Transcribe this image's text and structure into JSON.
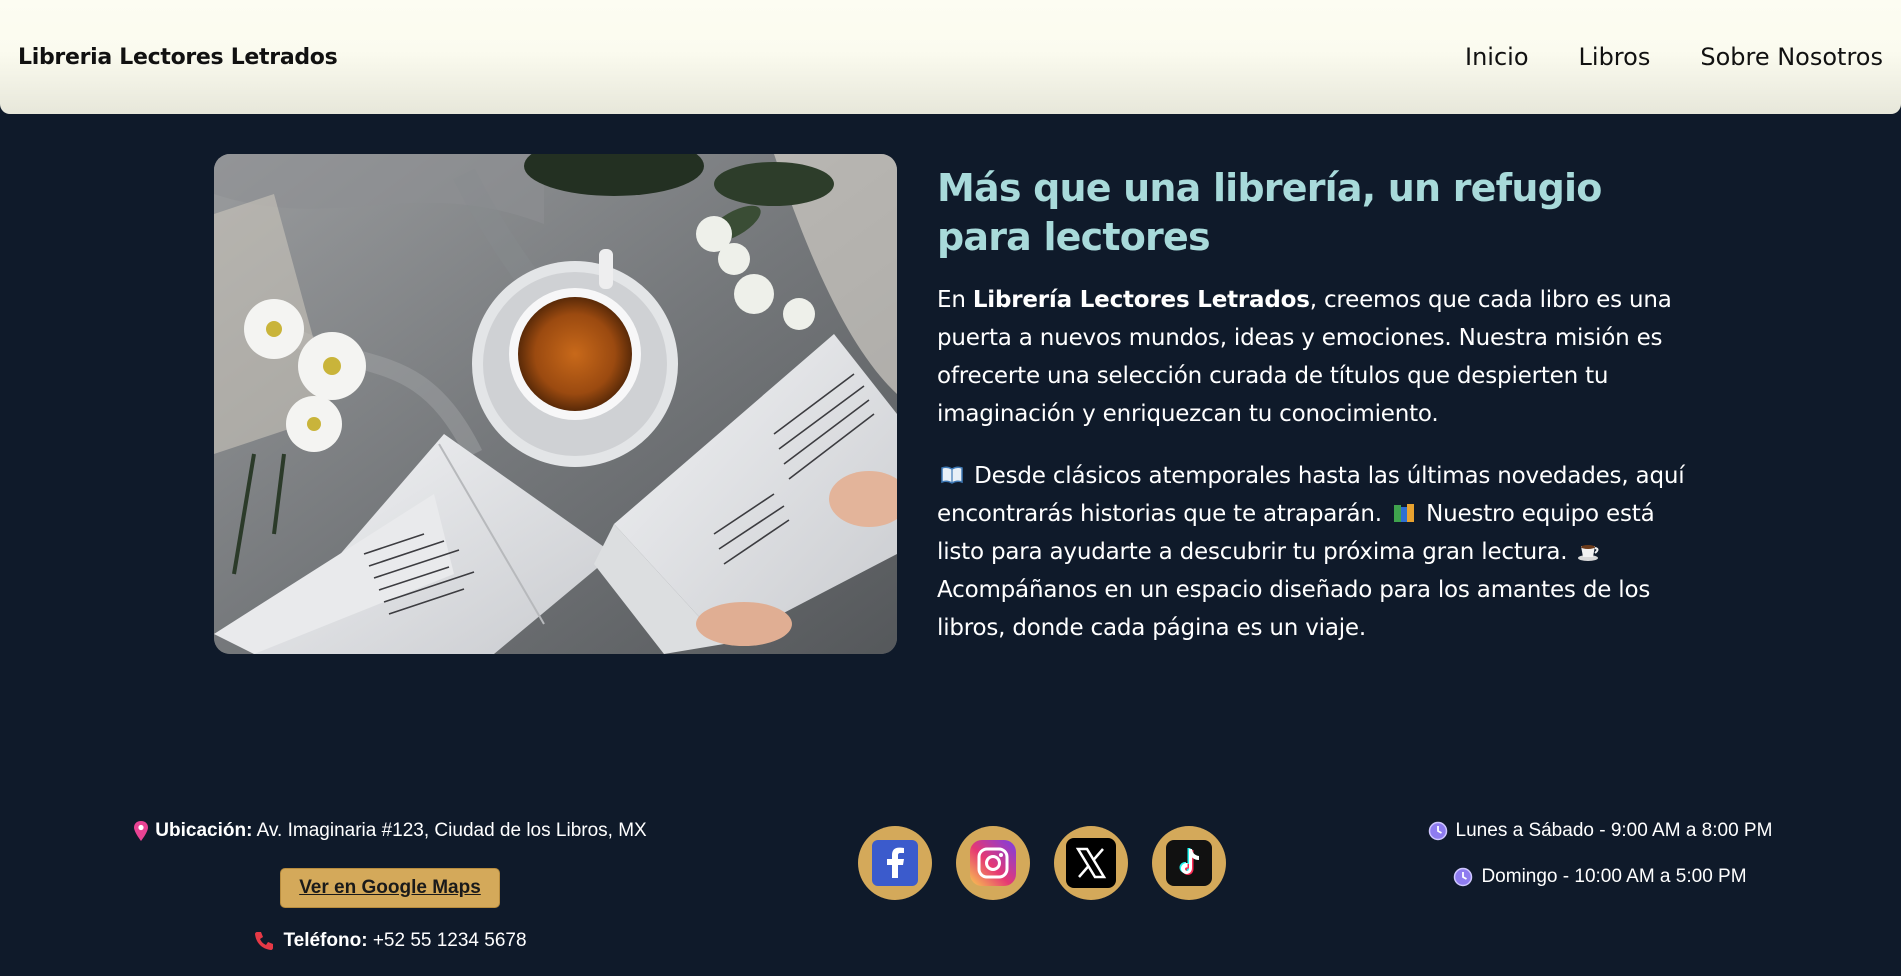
{
  "header": {
    "brand": "Libreria Lectores Letrados",
    "nav": [
      "Inicio",
      "Libros",
      "Sobre Nosotros"
    ]
  },
  "hero": {
    "image_alt": "Mesa con taza de té, flores y libros abiertos",
    "title": "Más que una librería, un refugio para lectores",
    "p1_prefix": "En ",
    "p1_bold": "Librería Lectores Letrados",
    "p1_rest": ", creemos que cada libro es una puerta a nuevos mundos, ideas y emociones. Nuestra misión es ofrecerte una selección curada de títulos que despierten tu imaginación y enriquezcan tu conocimiento.",
    "p2_a": "Desde clásicos atemporales hasta las últimas novedades, aquí encontrarás historias que te atraparán.",
    "p2_b": "Nuestro equipo está listo para ayudarte a descubrir tu próxima gran lectura.",
    "p2_c": "Acompáñanos en un espacio diseñado para los amantes de los libros, donde cada página es un viaje."
  },
  "footer": {
    "location_label": "Ubicación:",
    "location_value": "Av. Imaginaria #123, Ciudad de los Libros, MX",
    "maps_button": "Ver en Google Maps",
    "phone_label": "Teléfono:",
    "phone_value": "+52 55 1234 5678",
    "socials": [
      "facebook-icon",
      "instagram-icon",
      "x-icon",
      "tiktok-icon"
    ],
    "hours": [
      "Lunes a Sábado - 9:00 AM a 8:00 PM",
      "Domingo - 10:00 AM a 5:00 PM"
    ]
  },
  "colors": {
    "background": "#0f1a2a",
    "header": "#fbfbef",
    "title_accent": "#a8dada",
    "gold": "#d4a95a"
  }
}
